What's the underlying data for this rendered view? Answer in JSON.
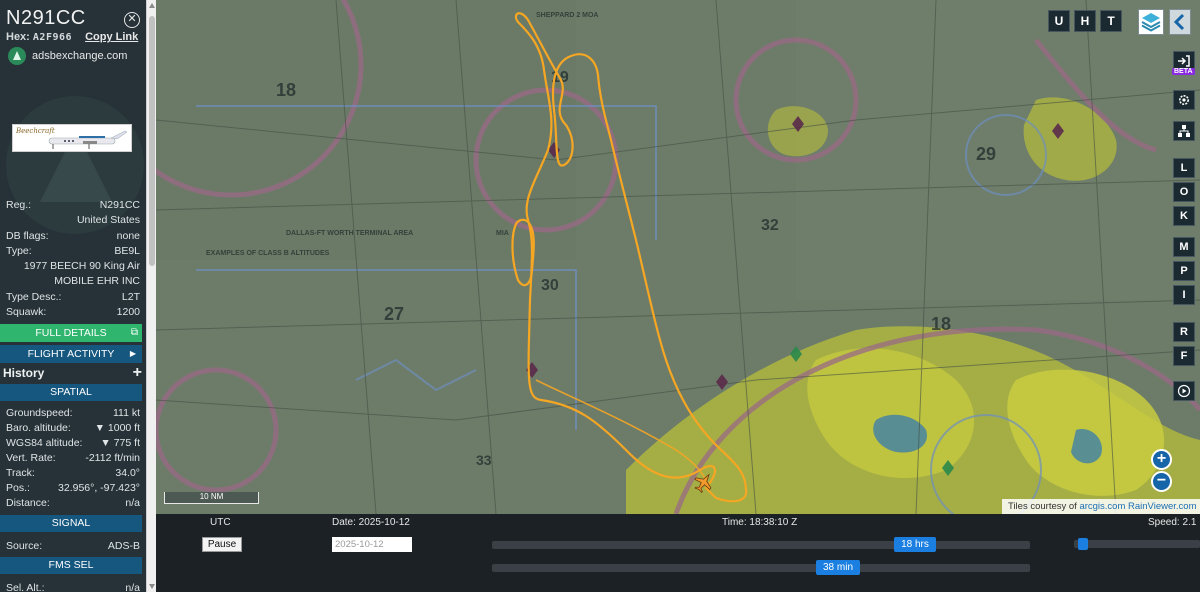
{
  "aircraft": {
    "callsign": "N291CC",
    "hex_label": "Hex:",
    "hex": "A2F966",
    "copy_link": "Copy Link",
    "source_site": "adsbexchange.com",
    "photo_brand": "Beechcraft"
  },
  "details": [
    {
      "label": "Reg.:",
      "value": "N291CC"
    },
    {
      "label": "",
      "value": "United States"
    },
    {
      "label": "DB flags:",
      "value": "none"
    },
    {
      "label": "Type:",
      "value": "BE9L"
    },
    {
      "label": "",
      "value": "1977 BEECH 90 King Air"
    },
    {
      "label": "",
      "value": "MOBILE EHR INC"
    },
    {
      "label": "Type Desc.:",
      "value": "L2T"
    },
    {
      "label": "Squawk:",
      "value": "1200"
    }
  ],
  "buttons": {
    "full_details": "FULL DETAILS",
    "flight_activity": "FLIGHT ACTIVITY",
    "history": "History"
  },
  "sections": {
    "spatial": "SPATIAL",
    "signal": "SIGNAL",
    "fms_sel": "FMS SEL"
  },
  "spatial": [
    {
      "label": "Groundspeed:",
      "value": "111 kt"
    },
    {
      "label": "Baro. altitude:",
      "value": "▼ 1000 ft"
    },
    {
      "label": "WGS84 altitude:",
      "value": "▼ 775 ft"
    },
    {
      "label": "Vert. Rate:",
      "value": "-2112 ft/min"
    },
    {
      "label": "Track:",
      "value": "34.0°"
    },
    {
      "label": "Pos.:",
      "value": "32.956°, -97.423°"
    },
    {
      "label": "Distance:",
      "value": "n/a"
    }
  ],
  "signal": [
    {
      "label": "Source:",
      "value": "ADS-B"
    }
  ],
  "fms": [
    {
      "label": "Sel. Alt.:",
      "value": "n/a"
    }
  ],
  "map": {
    "top_buttons": [
      "U",
      "H",
      "T"
    ],
    "side_buttons": [
      "L",
      "O",
      "K",
      "M",
      "P",
      "I",
      "R",
      "F"
    ],
    "beta_badge": "BETA",
    "zoom_in": "+",
    "zoom_out": "−",
    "scale_label": "10 NM",
    "attribution_prefix": "Tiles courtesy of",
    "attribution_link": "arcgis.com RainViewer.com",
    "track_color": "#f5a623"
  },
  "chart_labels": {
    "sheppard": "SHEPPARD 2 MOA",
    "dfw_area": "DALLAS-FT WORTH TERMINAL AREA",
    "class_b": "EXAMPLES OF CLASS B ALTITUDES",
    "mia": "MIA"
  },
  "timeline": {
    "utc_label": "UTC",
    "date_label": "Date: 2025-10-12",
    "time_label": "Time: 18:38:10 Z",
    "speed_label": "Speed: 2.1",
    "pause": "Pause",
    "date_value": "2025-10-12",
    "hours_handle": "18 hrs",
    "minutes_handle": "38 min"
  }
}
